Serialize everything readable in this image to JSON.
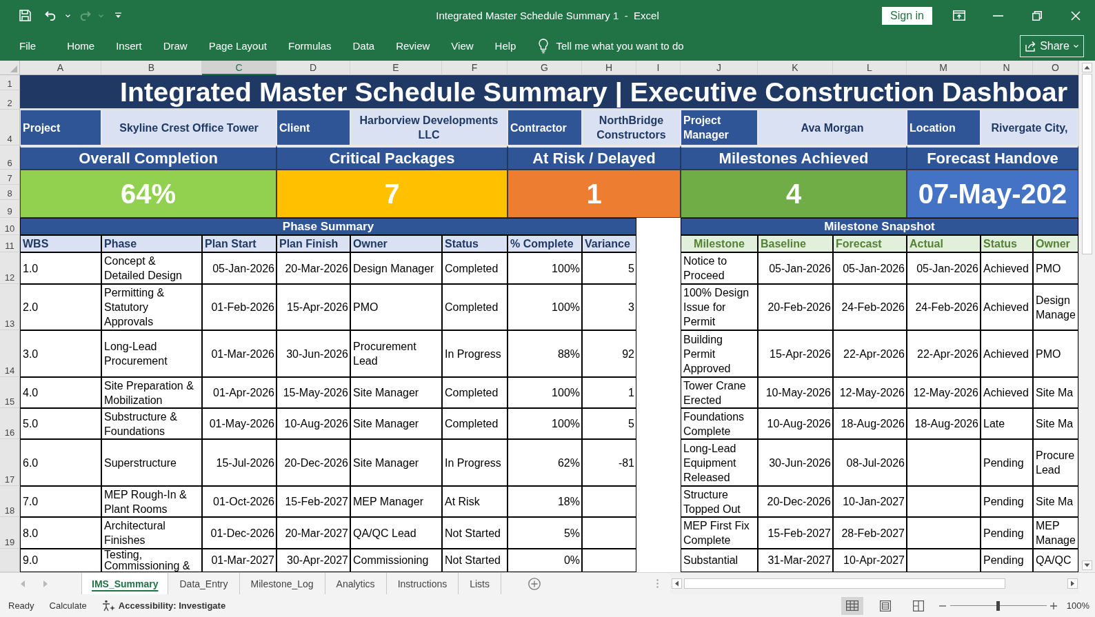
{
  "window": {
    "title": "Integrated Master Schedule Summary 1  -  Excel",
    "sign_in": "Sign in"
  },
  "ribbon": {
    "tabs": [
      "File",
      "Home",
      "Insert",
      "Draw",
      "Page Layout",
      "Formulas",
      "Data",
      "Review",
      "View",
      "Help"
    ],
    "tell_me": {
      "placeholder": "Tell me what you want to do"
    },
    "share": "Share"
  },
  "column_headers": [
    {
      "label": "A",
      "selected": false
    },
    {
      "label": "B",
      "selected": false
    },
    {
      "label": "C",
      "selected": true
    },
    {
      "label": "D",
      "selected": false
    },
    {
      "label": "E",
      "selected": false
    },
    {
      "label": "F",
      "selected": false
    },
    {
      "label": "G",
      "selected": false
    },
    {
      "label": "H",
      "selected": false
    },
    {
      "label": "I",
      "selected": false
    },
    {
      "label": "J",
      "selected": false
    },
    {
      "label": "K",
      "selected": false
    },
    {
      "label": "L",
      "selected": false
    },
    {
      "label": "M",
      "selected": false
    },
    {
      "label": "N",
      "selected": false
    },
    {
      "label": "O",
      "selected": false
    }
  ],
  "row_numbers": [
    "1",
    "2",
    "4",
    "6",
    "7",
    "8",
    "9",
    "10",
    "11",
    "12",
    "13",
    "14",
    "15",
    "16",
    "17",
    "18",
    "19"
  ],
  "sheet": {
    "title": "Integrated Master Schedule Summary | Executive Construction Dashboar",
    "info": [
      {
        "label": "Project",
        "value": "Skyline Crest Office Tower"
      },
      {
        "label": "Client",
        "value": "Harborview Developments LLC"
      },
      {
        "label": "Contractor",
        "value": "NorthBridge Constructors"
      },
      {
        "label": "Project Manager",
        "value": "Ava Morgan"
      },
      {
        "label": "Location",
        "value": "Rivergate City,"
      }
    ],
    "kpis": [
      {
        "title": "Overall Completion",
        "value": "64%",
        "color": "#92d050"
      },
      {
        "title": "Critical Packages",
        "value": "7",
        "color": "#ffc000"
      },
      {
        "title": "At Risk / Delayed",
        "value": "1",
        "color": "#ed7d31"
      },
      {
        "title": "Milestones Achieved",
        "value": "4",
        "color": "#70ad47"
      },
      {
        "title": "Forecast Handove",
        "value": "07-May-202",
        "color": "#4472c4"
      }
    ],
    "phase_summary": {
      "title": "Phase Summary",
      "columns": [
        "WBS",
        "Phase",
        "Plan Start",
        "Plan Finish",
        "Owner",
        "Status",
        "% Complete",
        "Variance"
      ],
      "rows": [
        {
          "wbs": "1.0",
          "phase": "Concept & Detailed Design",
          "plan_start": "05-Jan-2026",
          "plan_finish": "20-Mar-2026",
          "owner": "Design Manager",
          "status": "Completed",
          "complete": "100%",
          "variance": "5"
        },
        {
          "wbs": "2.0",
          "phase": "Permitting & Statutory Approvals",
          "plan_start": "01-Feb-2026",
          "plan_finish": "15-Apr-2026",
          "owner": "PMO",
          "status": "Completed",
          "complete": "100%",
          "variance": "3"
        },
        {
          "wbs": "3.0",
          "phase": "Long-Lead Procurement",
          "plan_start": "01-Mar-2026",
          "plan_finish": "30-Jun-2026",
          "owner": "Procurement Lead",
          "status": "In Progress",
          "complete": "88%",
          "variance": "92"
        },
        {
          "wbs": "4.0",
          "phase": "Site Preparation & Mobilization",
          "plan_start": "01-Apr-2026",
          "plan_finish": "15-May-2026",
          "owner": "Site Manager",
          "status": "Completed",
          "complete": "100%",
          "variance": "1"
        },
        {
          "wbs": "5.0",
          "phase": "Substructure & Foundations",
          "plan_start": "01-May-2026",
          "plan_finish": "10-Aug-2026",
          "owner": "Site Manager",
          "status": "Completed",
          "complete": "100%",
          "variance": "5"
        },
        {
          "wbs": "6.0",
          "phase": "Superstructure",
          "plan_start": "15-Jul-2026",
          "plan_finish": "20-Dec-2026",
          "owner": "Site Manager",
          "status": "In Progress",
          "complete": "62%",
          "variance": "-81"
        },
        {
          "wbs": "7.0",
          "phase": "MEP Rough-In & Plant Rooms",
          "plan_start": "01-Oct-2026",
          "plan_finish": "15-Feb-2027",
          "owner": "MEP Manager",
          "status": "At Risk",
          "complete": "18%"
        },
        {
          "wbs": "8.0",
          "phase": "Architectural Finishes",
          "plan_start": "01-Dec-2026",
          "plan_finish": "20-Mar-2027",
          "owner": "QA/QC Lead",
          "status": "Not Started",
          "complete": "5%"
        },
        {
          "wbs": "9.0",
          "phase": "Testing, Commissioning &",
          "plan_start": "01-Mar-2027",
          "plan_finish": "30-Apr-2027",
          "owner": "Commissioning",
          "status": "Not Started",
          "complete": "0%"
        }
      ]
    },
    "milestone_snapshot": {
      "title": "Milestone Snapshot",
      "columns": [
        "Milestone",
        "Baseline",
        "Forecast",
        "Actual",
        "Status",
        "Owner"
      ],
      "rows": [
        {
          "milestone": "Notice to Proceed",
          "baseline": "05-Jan-2026",
          "forecast": "05-Jan-2026",
          "actual": "05-Jan-2026",
          "status": "Achieved",
          "owner": "PMO"
        },
        {
          "milestone": "100% Design Issue for Permit",
          "baseline": "20-Feb-2026",
          "forecast": "24-Feb-2026",
          "actual": "24-Feb-2026",
          "status": "Achieved",
          "owner": "Design Manage"
        },
        {
          "milestone": "Building Permit Approved",
          "baseline": "15-Apr-2026",
          "forecast": "22-Apr-2026",
          "actual": "22-Apr-2026",
          "status": "Achieved",
          "owner": "PMO"
        },
        {
          "milestone": "Tower Crane Erected",
          "baseline": "10-May-2026",
          "forecast": "12-May-2026",
          "actual": "12-May-2026",
          "status": "Achieved",
          "owner": "Site Ma"
        },
        {
          "milestone": "Foundations Complete",
          "baseline": "10-Aug-2026",
          "forecast": "18-Aug-2026",
          "actual": "18-Aug-2026",
          "status": "Late",
          "owner": "Site Ma"
        },
        {
          "milestone": "Long-Lead Equipment Released",
          "baseline": "30-Jun-2026",
          "forecast": "08-Jul-2026",
          "status": "Pending",
          "owner": "Procure Lead"
        },
        {
          "milestone": "Structure Topped Out",
          "baseline": "20-Dec-2026",
          "forecast": "10-Jan-2027",
          "status": "Pending",
          "owner": "Site Ma"
        },
        {
          "milestone": "MEP First Fix Complete",
          "baseline": "15-Feb-2027",
          "forecast": "28-Feb-2027",
          "status": "Pending",
          "owner": "MEP Manage"
        },
        {
          "milestone": "Substantial",
          "baseline": "31-Mar-2027",
          "forecast": "10-Apr-2027",
          "status": "Pending",
          "owner": "QA/QC"
        }
      ]
    }
  },
  "sheet_tabs": [
    {
      "label": "IMS_Summary",
      "selected": true
    },
    {
      "label": "Data_Entry",
      "selected": false
    },
    {
      "label": "Milestone_Log",
      "selected": false
    },
    {
      "label": "Analytics",
      "selected": false
    },
    {
      "label": "Instructions",
      "selected": false
    },
    {
      "label": "Lists",
      "selected": false
    }
  ],
  "status_bar": {
    "ready": "Ready",
    "calculate": "Calculate",
    "accessibility": "Accessibility: Investigate",
    "views": [
      {
        "kind": "normal",
        "selected": true
      },
      {
        "kind": "page_layout",
        "selected": false
      },
      {
        "kind": "page_break",
        "selected": false
      }
    ],
    "zoom_slider": {
      "level": 0.5
    },
    "zoom": "100%"
  }
}
